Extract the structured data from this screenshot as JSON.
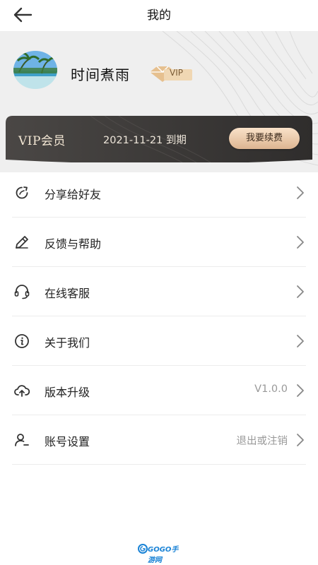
{
  "topbar": {
    "title": "我的",
    "back_icon": "arrow-left-icon"
  },
  "profile": {
    "username": "时间煮雨",
    "vip_badge": "VIP",
    "avatar": "beach-palm-photo"
  },
  "vip_card": {
    "title": "VIP会员",
    "expire": "2021-11-21 到期",
    "renew_label": "我要续费",
    "colors": {
      "card": "#3a3836",
      "button": "#e9c9a8"
    }
  },
  "menu": [
    {
      "label": "分享给好友",
      "icon": "share-icon",
      "value": ""
    },
    {
      "label": "反馈与帮助",
      "icon": "pencil-icon",
      "value": ""
    },
    {
      "label": "在线客服",
      "icon": "headset-icon",
      "value": ""
    },
    {
      "label": "关于我们",
      "icon": "info-icon",
      "value": ""
    },
    {
      "label": "版本升级",
      "icon": "cloud-upload-icon",
      "value": "V1.0.0"
    },
    {
      "label": "账号设置",
      "icon": "user-settings-icon",
      "value": "退出或注销"
    }
  ],
  "watermark": {
    "logo": "GOGO手游网"
  }
}
